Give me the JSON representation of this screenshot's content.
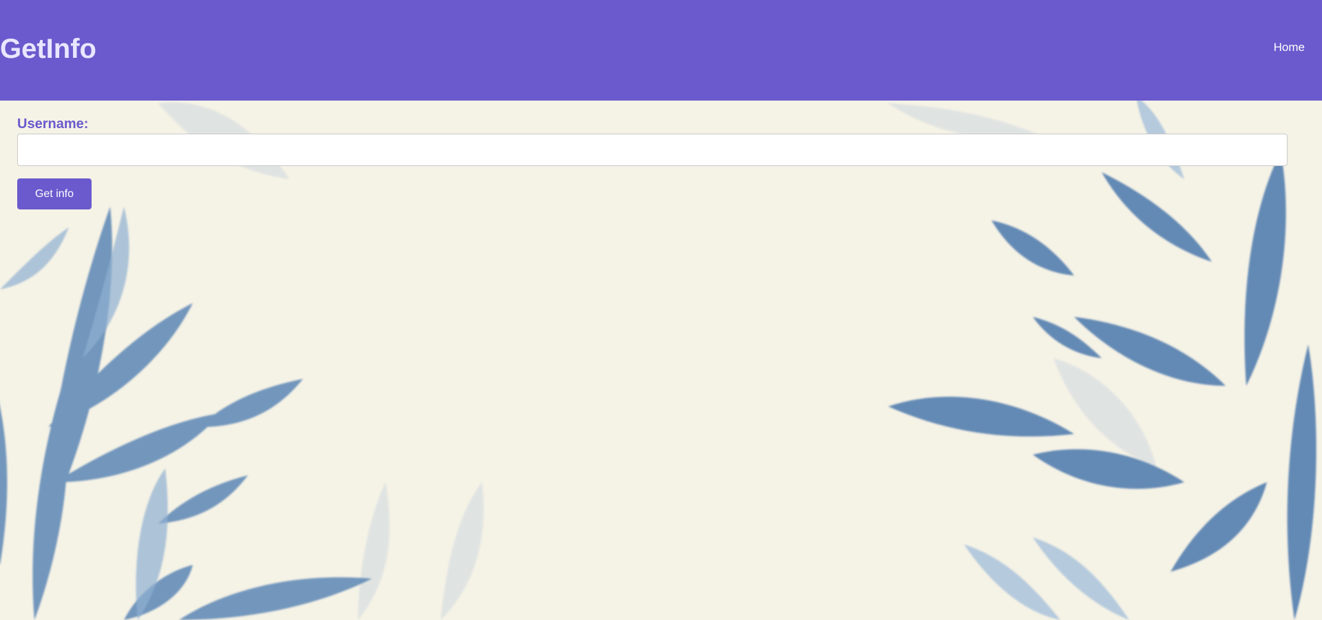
{
  "theme": {
    "header_bg": "#6a5acd",
    "brand_color": "#e9e6ff",
    "nav_color": "#ffffff",
    "label_color": "#6a5acd",
    "button_bg": "#6a5acd",
    "button_text": "#ffffff",
    "page_bg": "#f5f2e6",
    "leaf_color": "#4a77a8"
  },
  "header": {
    "brand": "GetInfo",
    "nav": [
      "Home"
    ]
  },
  "form": {
    "username_label": "Username:",
    "username_value": "",
    "username_placeholder": "",
    "submit_label": "Get info"
  },
  "background": {
    "icon": "watercolor-leaves-illustration"
  }
}
